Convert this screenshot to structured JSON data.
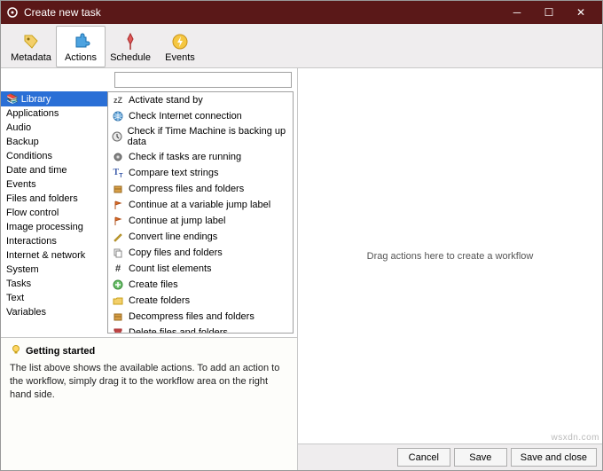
{
  "window": {
    "title": "Create new task"
  },
  "toolbar": {
    "tabs": [
      {
        "id": "metadata",
        "label": "Metadata",
        "icon": "tag-icon"
      },
      {
        "id": "actions",
        "label": "Actions",
        "icon": "puzzle-icon"
      },
      {
        "id": "schedule",
        "label": "Schedule",
        "icon": "pin-icon"
      },
      {
        "id": "events",
        "label": "Events",
        "icon": "bolt-icon"
      }
    ],
    "active": "actions"
  },
  "search": {
    "placeholder": ""
  },
  "categories": [
    "Library",
    "Applications",
    "Audio",
    "Backup",
    "Conditions",
    "Date and time",
    "Events",
    "Files and folders",
    "Flow control",
    "Image processing",
    "Interactions",
    "Internet & network",
    "System",
    "Tasks",
    "Text",
    "Variables"
  ],
  "selected_category": "Library",
  "actions": [
    {
      "label": "Activate stand by",
      "icon": "zz"
    },
    {
      "label": "Check Internet connection",
      "icon": "globe"
    },
    {
      "label": "Check if Time Machine is backing up data",
      "icon": "clock"
    },
    {
      "label": "Check if tasks are running",
      "icon": "gear"
    },
    {
      "label": "Compare text strings",
      "icon": "tt"
    },
    {
      "label": "Compress files and folders",
      "icon": "box"
    },
    {
      "label": "Continue at a variable jump label",
      "icon": "flag"
    },
    {
      "label": "Continue at jump label",
      "icon": "flag"
    },
    {
      "label": "Convert line endings",
      "icon": "pencil"
    },
    {
      "label": "Copy files and folders",
      "icon": "copy"
    },
    {
      "label": "Count list elements",
      "icon": "hash"
    },
    {
      "label": "Create files",
      "icon": "plus"
    },
    {
      "label": "Create folders",
      "icon": "folder"
    },
    {
      "label": "Decompress files and folders",
      "icon": "box"
    },
    {
      "label": "Delete files and folders",
      "icon": "trash"
    }
  ],
  "workflow": {
    "placeholder": "Drag actions here to create a workflow"
  },
  "help": {
    "title": "Getting started",
    "text": "The list above shows the available actions. To add an action to the workflow, simply drag it to the workflow area on the right hand side."
  },
  "footer": {
    "cancel": "Cancel",
    "save": "Save",
    "save_close": "Save and close"
  },
  "watermark": "wsxdn.com"
}
